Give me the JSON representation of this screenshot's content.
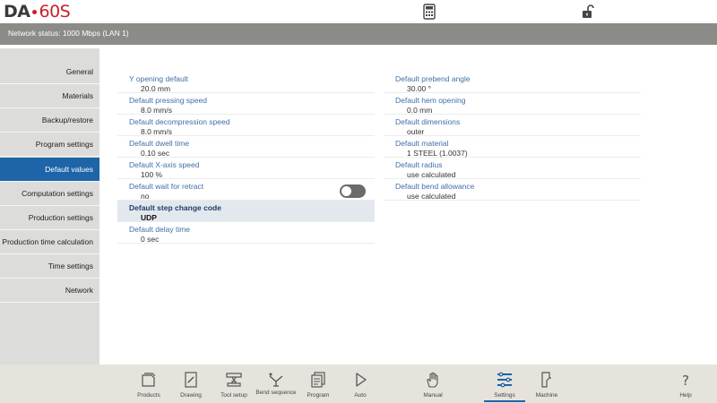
{
  "app": {
    "logo_brand": "DA",
    "logo_model": "60S",
    "calculator_icon": "calculator-icon",
    "lock_icon": "unlock-icon"
  },
  "status": {
    "text": "Network status: 1000 Mbps (LAN 1)"
  },
  "sidebar": {
    "items": [
      {
        "label": "General"
      },
      {
        "label": "Materials"
      },
      {
        "label": "Backup/restore"
      },
      {
        "label": "Program settings"
      },
      {
        "label": "Default values",
        "active": true
      },
      {
        "label": "Computation settings"
      },
      {
        "label": "Production settings"
      },
      {
        "label": "Production time calculation"
      },
      {
        "label": "Time settings"
      },
      {
        "label": "Network"
      }
    ]
  },
  "left_fields": [
    {
      "label": "Y opening default",
      "value": "20.0 mm"
    },
    {
      "label": "Default pressing speed",
      "value": "8.0 mm/s"
    },
    {
      "label": "Default decompression speed",
      "value": "8.0 mm/s"
    },
    {
      "label": "Default dwell time",
      "value": "0.10 sec"
    },
    {
      "label": "Default X-axis speed",
      "value": "100 %"
    },
    {
      "label": "Default wait for retract",
      "value": "no",
      "toggle": "off"
    },
    {
      "label": "Default step change code",
      "value": "UDP",
      "selected": true
    },
    {
      "label": "Default delay time",
      "value": "0 sec"
    }
  ],
  "right_fields": [
    {
      "label": "Default prebend angle",
      "value": "30.00 °"
    },
    {
      "label": "Default hem opening",
      "value": "0.0 mm"
    },
    {
      "label": "Default dimensions",
      "value": "outer"
    },
    {
      "label": "Default material",
      "value": "1 STEEL (1.0037)"
    },
    {
      "label": "Default radius",
      "value": "use calculated"
    },
    {
      "label": "Default bend allowance",
      "value": "use calculated"
    }
  ],
  "bottom_nav": [
    {
      "label": "Products",
      "icon": "products-icon"
    },
    {
      "label": "Drawing",
      "icon": "drawing-icon"
    },
    {
      "label": "Tool setup",
      "icon": "tool-setup-icon"
    },
    {
      "label": "Bend sequence",
      "icon": "bend-sequence-icon"
    },
    {
      "label": "Program",
      "icon": "program-icon"
    },
    {
      "label": "Auto",
      "icon": "play-icon"
    },
    {
      "label": "Manual",
      "icon": "hand-icon"
    },
    {
      "label": "Settings",
      "icon": "settings-icon",
      "active": true
    },
    {
      "label": "Machine",
      "icon": "machine-icon"
    },
    {
      "label": "Help",
      "icon": "help-icon"
    }
  ],
  "colors": {
    "accent": "#1d64a8",
    "statusbar": "#8b8b87",
    "sidebar": "#dcdcda",
    "bottombar": "#e5e3dc",
    "logo_red": "#c8202c"
  }
}
